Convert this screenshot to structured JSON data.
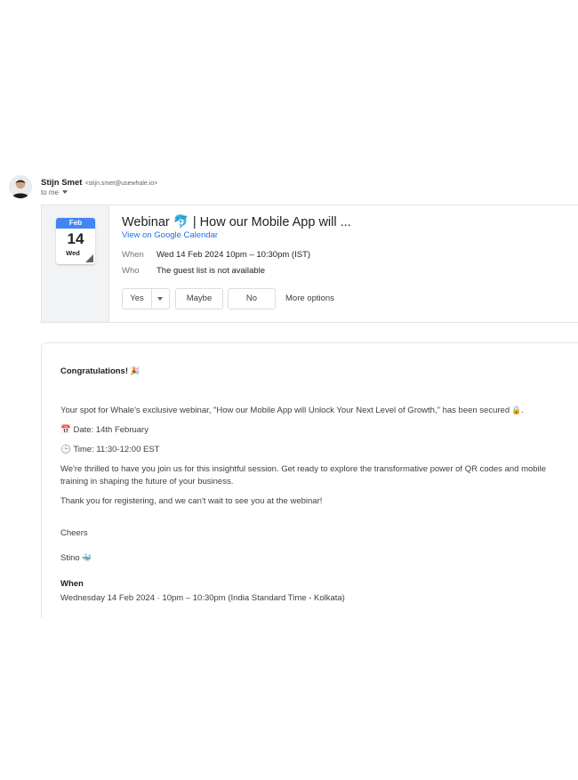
{
  "sender": {
    "name": "Stijn Smet",
    "email": "<stijn.smet@usewhale.io>",
    "to_label": "to me"
  },
  "invite": {
    "calendar_icon": {
      "month": "Feb",
      "day": "14",
      "weekday": "Wed"
    },
    "title_prefix": "Webinar",
    "title_emoji": "🐬",
    "title_suffix": "| How our Mobile App will ...",
    "calendar_link": "View on Google Calendar",
    "when_label": "When",
    "when_value": "Wed 14 Feb 2024 10pm – 10:30pm (IST)",
    "who_label": "Who",
    "who_value": "The guest list is not available",
    "rsvp": {
      "yes": "Yes",
      "maybe": "Maybe",
      "no": "No",
      "more_options": "More options"
    }
  },
  "body": {
    "greeting": "Congratulations!",
    "greeting_emoji": "🎉",
    "intro": "Your spot for Whale's exclusive webinar, \"How our Mobile App will Unlock Your Next Level of Growth,\" has been secured",
    "intro_emoji": "🔒",
    "intro_end": ".",
    "date_emoji": "📅",
    "date_text": "Date: 14th February",
    "time_emoji": "🕒",
    "time_text": "Time: 11:30-12:00 EST",
    "paragraph": "We're thrilled to have you join us for this insightful session. Get ready to explore the transformative power of QR codes and mobile training in shaping the future of your business.",
    "thanks": "Thank you for registering, and we can't wait to see you at the webinar!",
    "signoff": "Cheers",
    "signature": "Stino",
    "signature_emoji": "🐳",
    "when_heading": "When",
    "when_detail": "Wednesday 14 Feb 2024 · 10pm – 10:30pm (India Standard Time - Kolkata)"
  }
}
